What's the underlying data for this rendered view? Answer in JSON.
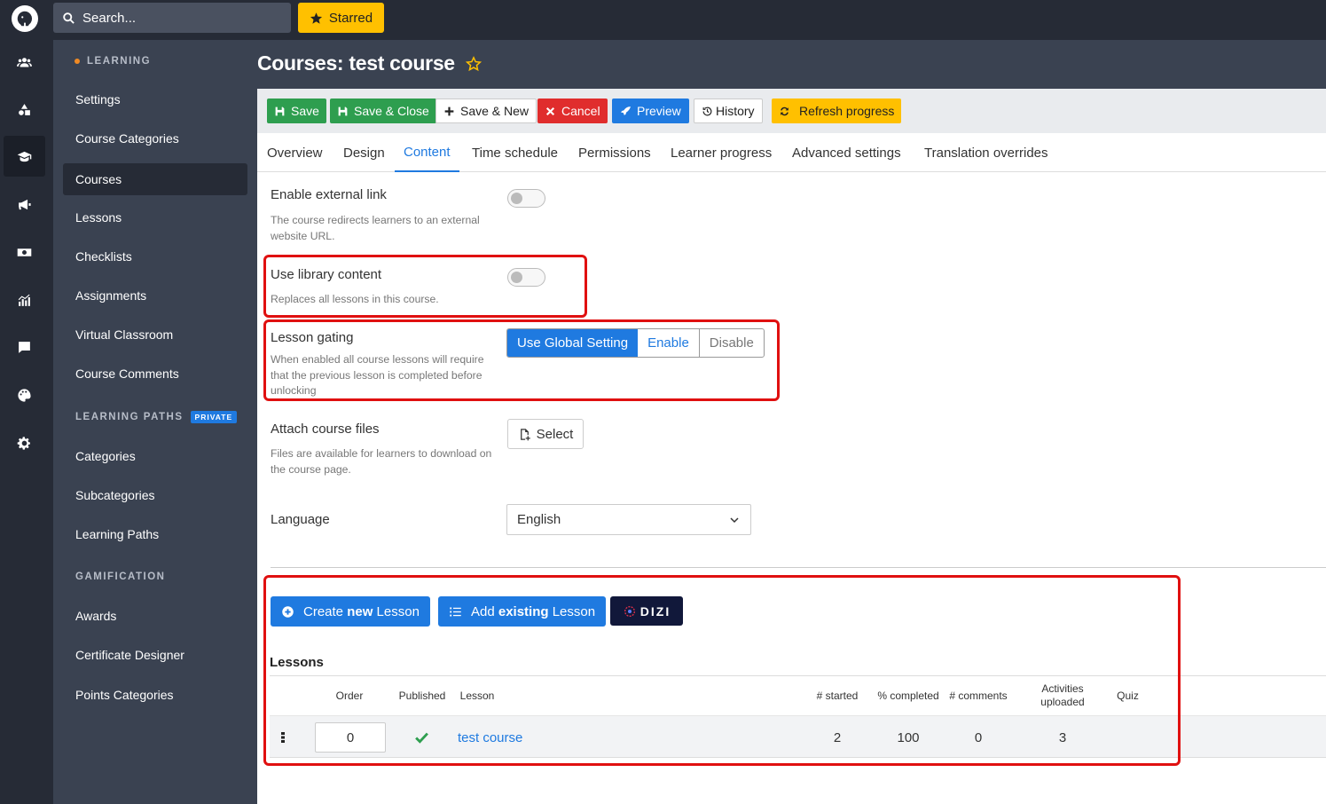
{
  "topbar": {
    "search_placeholder": "Search...",
    "starred_label": "Starred"
  },
  "rail_icons": [
    "users-icon",
    "shapes-icon",
    "graduation-cap-icon",
    "megaphone-icon",
    "money-icon",
    "chart-icon",
    "comment-icon",
    "palette-icon",
    "gear-icon"
  ],
  "nav": {
    "learning_header": "LEARNING",
    "learning_items": [
      "Settings",
      "Course Categories",
      "Courses",
      "Lessons",
      "Checklists",
      "Assignments",
      "Virtual Classroom",
      "Course Comments"
    ],
    "paths_header": "LEARNING PATHS",
    "paths_badge": "PRIVATE",
    "paths_items": [
      "Categories",
      "Subcategories",
      "Learning Paths"
    ],
    "gamification_header": "GAMIFICATION",
    "gamification_items": [
      "Awards",
      "Certificate Designer",
      "Points Categories"
    ],
    "active_item": "Courses"
  },
  "page": {
    "title": "Courses: test course"
  },
  "toolbar": {
    "save": "Save",
    "save_close": "Save & Close",
    "save_new": "Save & New",
    "cancel": "Cancel",
    "preview": "Preview",
    "history": "History",
    "refresh": "Refresh progress"
  },
  "tabs": [
    "Overview",
    "Design",
    "Content",
    "Time schedule",
    "Permissions",
    "Learner progress",
    "Advanced settings",
    "Translation overrides"
  ],
  "active_tab": "Content",
  "fields": {
    "external_link": {
      "label": "Enable external link",
      "help": "The course redirects learners to an external website URL.",
      "enabled": false
    },
    "library_content": {
      "label": "Use library content",
      "help": "Replaces all lessons in this course.",
      "enabled": false
    },
    "lesson_gating": {
      "label": "Lesson gating",
      "help": "When enabled all course lessons will require that the previous lesson is completed before unlocking",
      "options": [
        "Use Global Setting",
        "Enable",
        "Disable"
      ],
      "selected": "Use Global Setting"
    },
    "attach_files": {
      "label": "Attach course files",
      "help": "Files are available for learners to download on the course page.",
      "button": "Select"
    },
    "language": {
      "label": "Language",
      "value": "English"
    }
  },
  "lesson_actions": {
    "create_pre": "Create ",
    "create_bold": "new",
    "create_post": " Lesson",
    "add_pre": "Add ",
    "add_bold": "existing",
    "add_post": " Lesson",
    "dizi_label": "DIZI"
  },
  "lessons": {
    "title": "Lessons",
    "columns": [
      "Order",
      "Published",
      "Lesson",
      "# started",
      "% completed",
      "# comments",
      "Activities uploaded",
      "Quiz"
    ],
    "rows": [
      {
        "order": "0",
        "published": true,
        "lesson": "test course",
        "started": "2",
        "completed": "100",
        "comments": "0",
        "activities": "3",
        "quiz": ""
      }
    ]
  },
  "colors": {
    "accent": "#1f7ae0",
    "highlight": "#e01010",
    "sidebar": "#3a4251",
    "rail": "#262b36",
    "starred": "#ffc000"
  }
}
